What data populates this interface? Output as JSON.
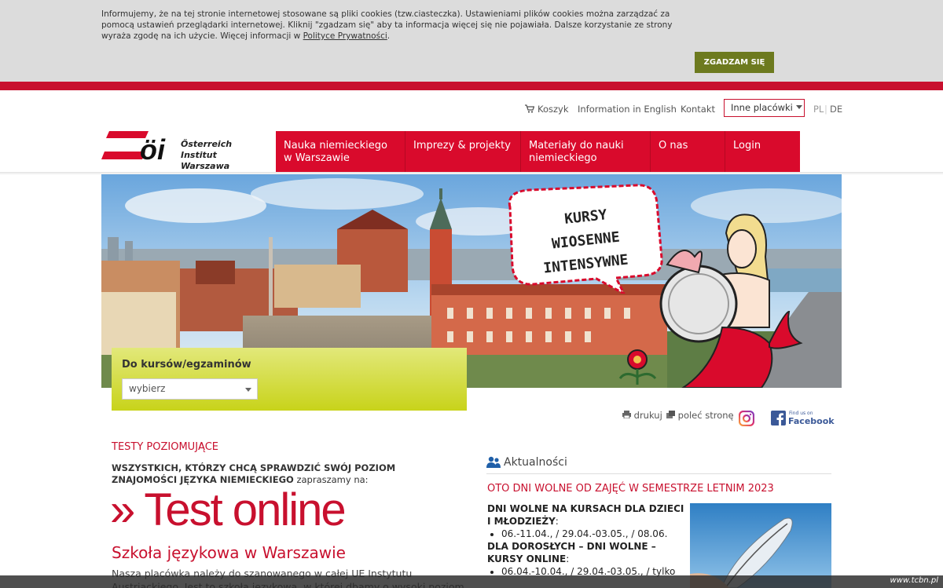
{
  "cookie": {
    "text_1": "Informujemy, że na tej stronie internetowej stosowane są pliki cookies (tzw.ciasteczka). Ustawieniami plików cookies można zarządzać za pomocą ustawień przeglądarki internetowej. Kliknij \"zgadzam się\" aby ta informacja więcej się nie pojawiała. Dalsze korzystanie ze strony wyraża zgodę na ich użycie. Więcej informacji w ",
    "link": "Polityce Prywatności",
    "text_2": ".",
    "button": "ZGADZAM SIĘ"
  },
  "toplinks": {
    "cart": "Koszyk",
    "english": "Information in English",
    "contact": "Kontakt",
    "branches": "Inne placówki",
    "lang_pl": "PL",
    "lang_sep": "|",
    "lang_de": "DE"
  },
  "logo": {
    "mark": "öi",
    "line1": "Österreich Institut",
    "line2": "Warszawa"
  },
  "nav": [
    {
      "line1": "Nauka niemieckiego",
      "line2": "w Warszawie"
    },
    {
      "line1": "Imprezy & projekty",
      "line2": ""
    },
    {
      "line1": "Materiały do nauki",
      "line2": "niemieckiego"
    },
    {
      "line1": "O nas",
      "line2": ""
    },
    {
      "line1": "Login",
      "line2": ""
    }
  ],
  "hero": {
    "bubble_1": "KURSY",
    "bubble_2": "WIOSENNE",
    "bubble_3": "INTENSYWNE"
  },
  "search": {
    "title": "Do kursów/egzaminów",
    "selected": "wybierz"
  },
  "share": {
    "print": "drukuj",
    "recommend": "poleć stronę",
    "facebook_small": "Find us on",
    "facebook": "Facebook"
  },
  "tests": {
    "heading": "TESTY POZIOMUJĄCE",
    "lead_bold": "WSZYSTKICH, KTÓRZY CHCĄ SPRAWDZIĆ SWÓJ POZIOM ZNAJOMOŚCI JĘZYKA NIEMIECKIEGO",
    "lead_rest": " zapraszamy na:",
    "link": "» Test online"
  },
  "school": {
    "title": "Szkoła językowa w Warszawie",
    "text": "Nasza placówka należy do szanowanego w całej UE Instytutu Austriackiego. Jest to szkoła językowa, w której dbamy o wysoki poziom kształcenia."
  },
  "news": {
    "heading": "Aktualności",
    "title": "OTO DNI WOLNE OD ZAJĘĆ W SEMESTRZE LETNIM 2023",
    "kids_head": "DNI WOLNE NA KURSACH DLA DZIECI I MŁODZIEŻY",
    "kids_colon": ":",
    "kids_item": "06.-11.04., / 29.04.-03.05., / 08.06.",
    "adults_head": "DLA DOROSŁYCH – DNI WOLNE – KURSY ONLINE",
    "adults_colon": ":",
    "adults_item": "06.04.-10.04., / 29.04.-03.05., / tylko"
  },
  "watermark": "www.tcbn.pl",
  "colors": {
    "brand_red": "#d90a2c",
    "accent_green": "#6d7a1f",
    "search_yellow": "#c8d31a"
  }
}
